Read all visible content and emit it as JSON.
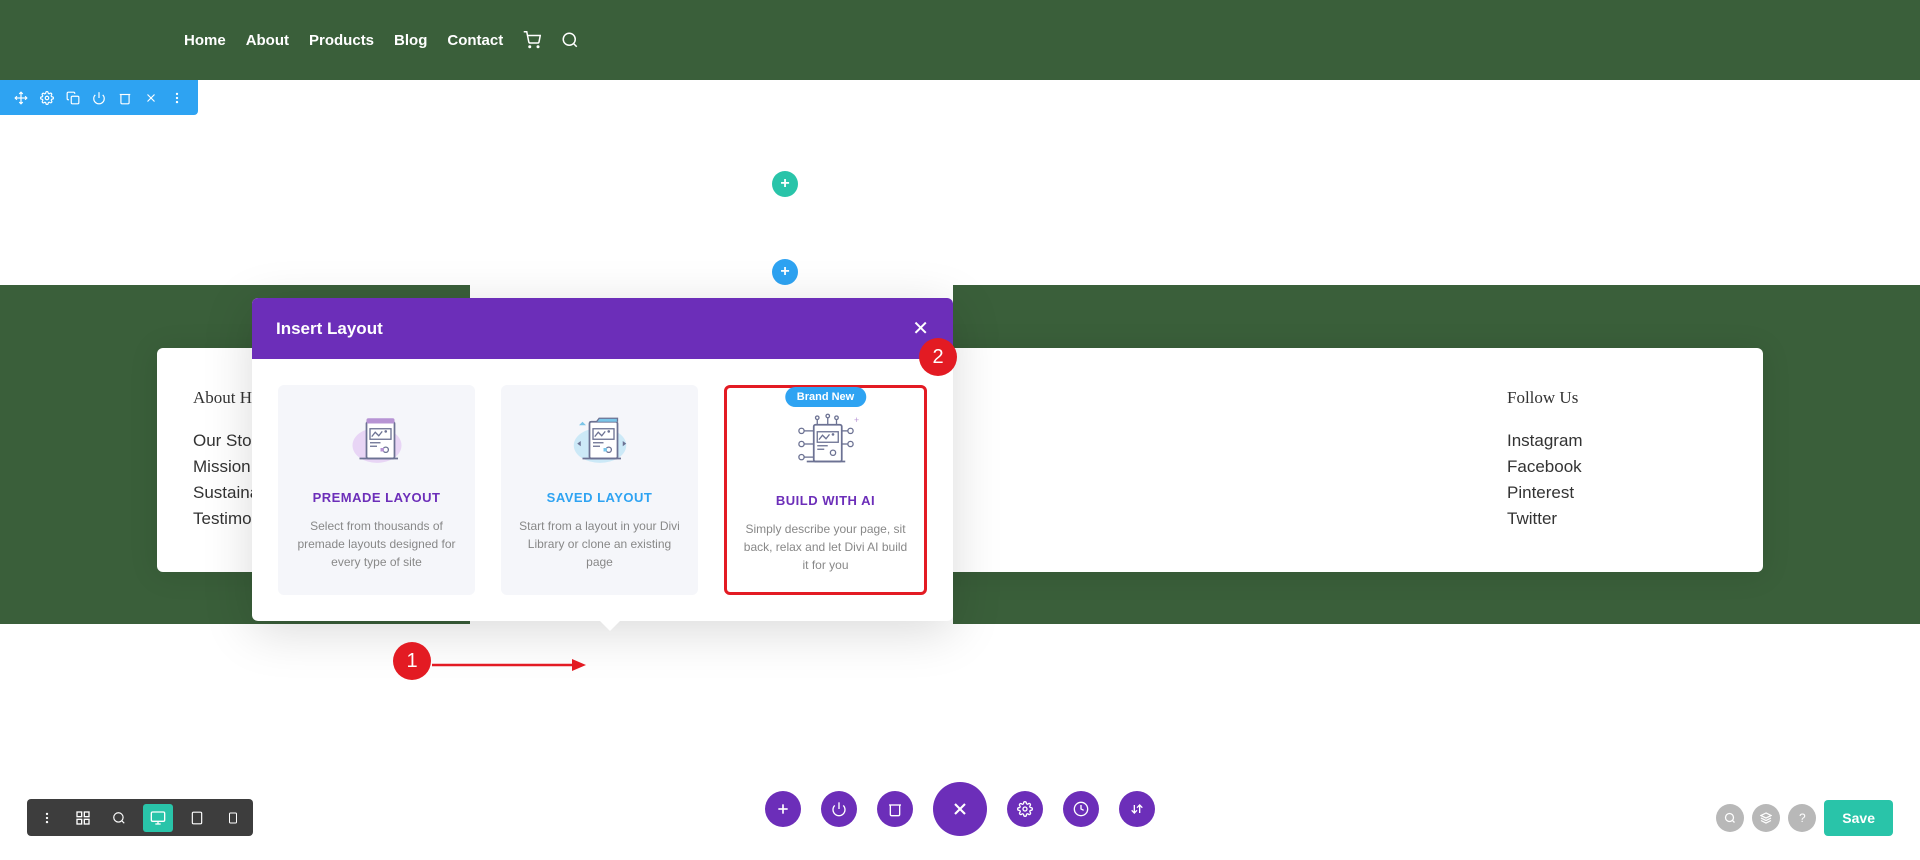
{
  "nav": {
    "items": [
      "Home",
      "About",
      "Products",
      "Blog",
      "Contact"
    ]
  },
  "footer": {
    "about": {
      "title": "About Hc",
      "links": [
        "Our Stor",
        "Mission",
        "Sustaina",
        "Testimon"
      ]
    },
    "follow": {
      "title": "Follow Us",
      "links": [
        "Instagram",
        "Facebook",
        "Pinterest",
        "Twitter"
      ]
    }
  },
  "modal": {
    "title": "Insert Layout",
    "cards": [
      {
        "title": "PREMADE LAYOUT",
        "desc": "Select from thousands of premade layouts designed for every type of site"
      },
      {
        "title": "SAVED LAYOUT",
        "desc": "Start from a layout in your Divi Library or clone an existing page"
      },
      {
        "badge": "Brand New",
        "title": "BUILD WITH AI",
        "desc": "Simply describe your page, sit back, relax and let Divi AI build it for you"
      }
    ]
  },
  "annotations": {
    "one": "1",
    "two": "2"
  },
  "save": "Save"
}
